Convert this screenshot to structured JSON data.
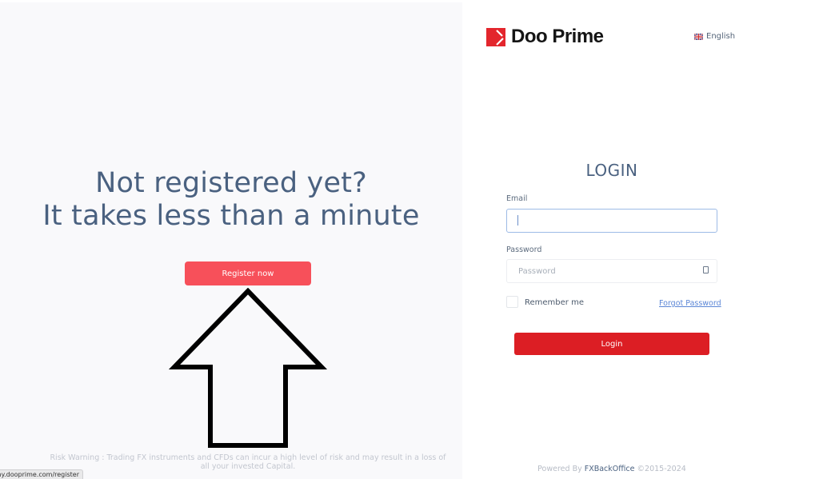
{
  "left_panel": {
    "headline_line1": "Not registered yet?",
    "headline_line2": "It takes less than a minute",
    "register_button": "Register now",
    "risk_warning": "Risk Warning : Trading FX instruments and CFDs can incur a high level of risk and may result in a loss of all your invested Capital.",
    "annotation_icon": "up-arrow-outline"
  },
  "status_bar": {
    "url": "https://my.dooprime.com/register/"
  },
  "header": {
    "logo_text": "Doo Prime",
    "logo_icon": "doo-prime-logo-mark",
    "language": "English",
    "language_flag": "uk-flag-icon"
  },
  "login_form": {
    "title": "LOGIN",
    "email_label": "Email",
    "email_value": "",
    "password_label": "Password",
    "password_placeholder": "Password",
    "password_value": "",
    "remember_label": "Remember me",
    "remember_checked": false,
    "forgot_password": "Forgot Password",
    "login_button": "Login"
  },
  "footer": {
    "prefix": "Powered By ",
    "brand": "FXBackOffice",
    "suffix": " ©2015-2024"
  },
  "colors": {
    "left_bg": "#f9f9fb",
    "headline": "#4a6180",
    "register_button": "#f7505a",
    "login_button": "#dc1e24",
    "link": "#5b86d6",
    "brand_red": "#e3262d"
  }
}
